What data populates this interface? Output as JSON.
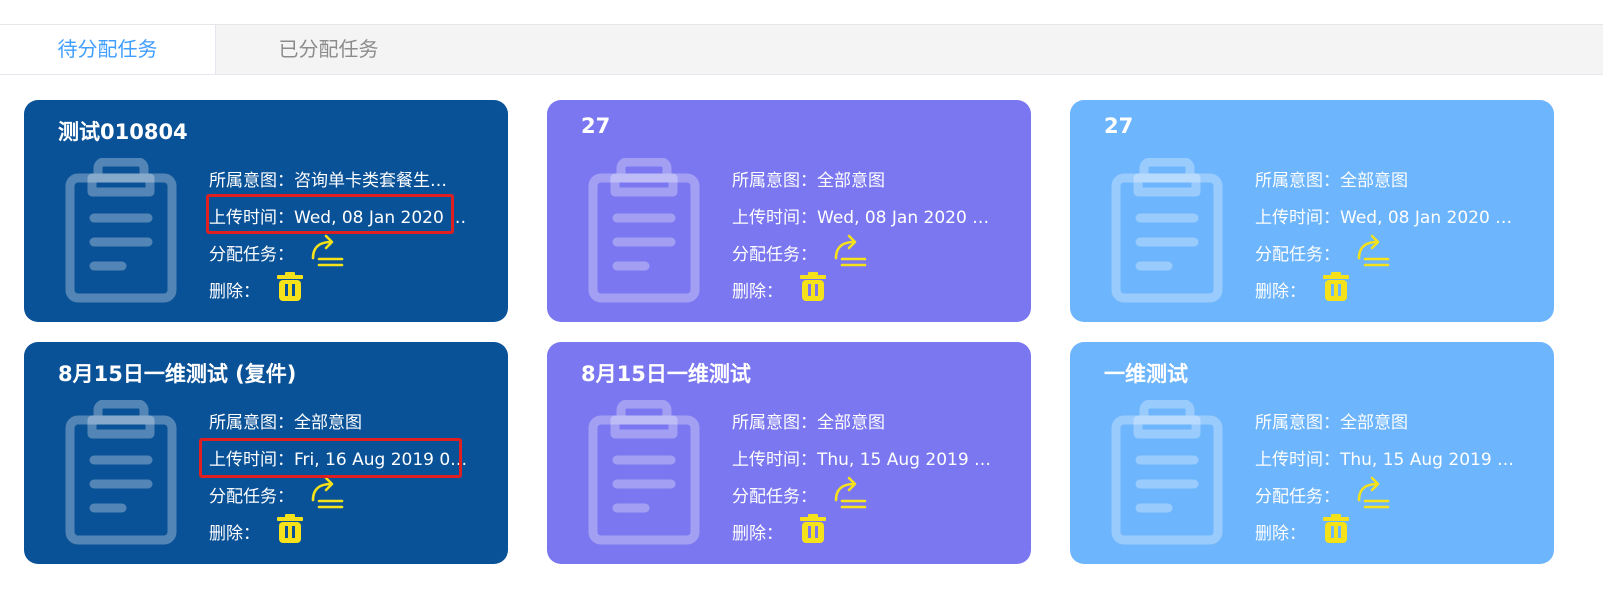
{
  "tabs": [
    {
      "label": "待分配任务",
      "active": true
    },
    {
      "label": "已分配任务",
      "active": false
    }
  ],
  "colors": {
    "card_dark_blue": "#0a5297",
    "card_purple": "#7b77f0",
    "card_light_blue": "#6db5fc",
    "action_yellow": "#f5e21b",
    "highlight_red": "#e02020",
    "tab_active": "#409eff"
  },
  "labels": {
    "intent": "所属意图：",
    "upload_time": "上传时间：",
    "assign": "分配任务：",
    "delete": "删除："
  },
  "cards": [
    {
      "title": "测试010804",
      "intent": "咨询单卡类套餐生…",
      "upload_time": "Wed, 08 Jan 2020 …",
      "highlighted": true
    },
    {
      "title": "27",
      "intent": "全部意图",
      "upload_time": "Wed, 08 Jan 2020 …",
      "highlighted": false
    },
    {
      "title": "27",
      "intent": "全部意图",
      "upload_time": "Wed, 08 Jan 2020 …",
      "highlighted": false
    },
    {
      "title": "8月15日一维测试 (复件)",
      "intent": "全部意图",
      "upload_time": "Fri, 16 Aug 2019 0…",
      "highlighted": true
    },
    {
      "title": "8月15日一维测试",
      "intent": "全部意图",
      "upload_time": "Thu, 15 Aug 2019 …",
      "highlighted": false
    },
    {
      "title": "一维测试",
      "intent": "全部意图",
      "upload_time": "Thu, 15 Aug 2019 …",
      "highlighted": false
    }
  ],
  "icons": {
    "card_icon": "clipboard-icon",
    "assign_icon": "share-arrow-icon",
    "delete_icon": "trash-icon"
  }
}
